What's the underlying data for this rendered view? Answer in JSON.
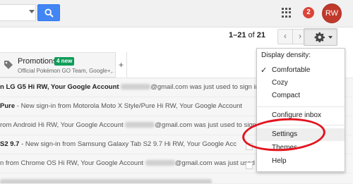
{
  "header": {
    "notification_count": "2",
    "avatar_initials": "RW",
    "icons": [
      "dropdown-caret-icon",
      "search-icon",
      "apps-grid-icon"
    ]
  },
  "toolbar": {
    "pager_range": "1–21",
    "pager_of": "of",
    "pager_total": "21",
    "prev_label": "‹",
    "next_label": "›",
    "settings_icon": "gear-icon"
  },
  "tabs": {
    "promotions": {
      "title": "Promotions",
      "badge": "4 new",
      "senders": "Official Pokémon GO Team, Google+,...",
      "icon": "tag-icon"
    },
    "add_label": "+"
  },
  "emails": [
    {
      "bold": "n LG G5 Hi RW, Your Google Account ",
      "rest": "@gmail.com was just used to sign in on L"
    },
    {
      "bold": "Pure",
      "rest": " - New sign-in from Motorola Moto X Style/Pure Hi RW, Your Google Account"
    },
    {
      "bold": "",
      "rest": "rom Android Hi RW, Your Google Account ",
      "rest2": "@gmail.com was just used to sign in on"
    },
    {
      "bold": "S2 9.7",
      "rest": " - New sign-in from Samsung Galaxy Tab S2 9.7 Hi RW, Your Google Acc"
    },
    {
      "bold": "",
      "rest": "n from Chrome OS Hi RW, Your Google Account ",
      "rest2": "@gmail.com was just used to sign"
    }
  ],
  "settings_menu": {
    "header": "Display density:",
    "check": "✓",
    "items": [
      "Comfortable",
      "Cozy",
      "Compact",
      "Configure inbox",
      "Settings",
      "Themes",
      "Help"
    ]
  },
  "colors": {
    "search_button": "#4285f4",
    "badge_red": "#db4437",
    "new_badge_green": "#0f9d58",
    "annotation_red": "#e3141f"
  }
}
